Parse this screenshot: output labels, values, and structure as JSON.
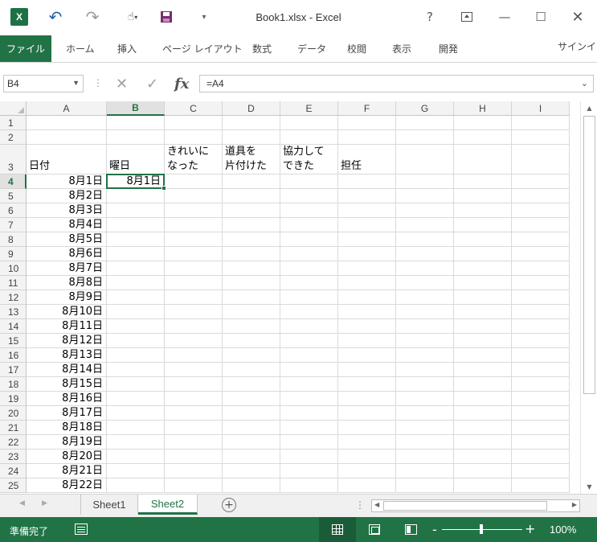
{
  "window": {
    "title": "Book1.xlsx - Excel",
    "logo_text": "X",
    "help": "?",
    "quick_access": [
      "undo-icon",
      "redo-icon",
      "touch-mode-icon",
      "save-icon",
      "customize-icon"
    ]
  },
  "ribbon": {
    "file_tab": "ファイル",
    "tabs": [
      "ホーム",
      "挿入",
      "ページ レイアウト",
      "数式",
      "データ",
      "校閲",
      "表示",
      "開発"
    ],
    "signin": "サインイン"
  },
  "formula_bar": {
    "name_box": "B4",
    "fx": "fx",
    "formula": "=A4"
  },
  "grid": {
    "columns": [
      "A",
      "B",
      "C",
      "D",
      "E",
      "F",
      "G",
      "H",
      "I"
    ],
    "selected_column": "B",
    "selected_row": "4",
    "rows": [
      {
        "n": "1",
        "cells": [
          "",
          "",
          "",
          "",
          "",
          "",
          "",
          "",
          ""
        ]
      },
      {
        "n": "2",
        "cells": [
          "",
          "",
          "",
          "",
          "",
          "",
          "",
          "",
          ""
        ]
      },
      {
        "n": "3",
        "cells": [
          "日付",
          "曜日",
          "きれいに\nなった",
          "道具を\n片付けた",
          "協力して\nできた",
          "担任",
          "",
          "",
          ""
        ]
      },
      {
        "n": "4",
        "cells": [
          "8月1日",
          "8月1日",
          "",
          "",
          "",
          "",
          "",
          "",
          ""
        ]
      },
      {
        "n": "5",
        "cells": [
          "8月2日",
          "",
          "",
          "",
          "",
          "",
          "",
          "",
          ""
        ]
      },
      {
        "n": "6",
        "cells": [
          "8月3日",
          "",
          "",
          "",
          "",
          "",
          "",
          "",
          ""
        ]
      },
      {
        "n": "7",
        "cells": [
          "8月4日",
          "",
          "",
          "",
          "",
          "",
          "",
          "",
          ""
        ]
      },
      {
        "n": "8",
        "cells": [
          "8月5日",
          "",
          "",
          "",
          "",
          "",
          "",
          "",
          ""
        ]
      },
      {
        "n": "9",
        "cells": [
          "8月6日",
          "",
          "",
          "",
          "",
          "",
          "",
          "",
          ""
        ]
      },
      {
        "n": "10",
        "cells": [
          "8月7日",
          "",
          "",
          "",
          "",
          "",
          "",
          "",
          ""
        ]
      },
      {
        "n": "11",
        "cells": [
          "8月8日",
          "",
          "",
          "",
          "",
          "",
          "",
          "",
          ""
        ]
      },
      {
        "n": "12",
        "cells": [
          "8月9日",
          "",
          "",
          "",
          "",
          "",
          "",
          "",
          ""
        ]
      },
      {
        "n": "13",
        "cells": [
          "8月10日",
          "",
          "",
          "",
          "",
          "",
          "",
          "",
          ""
        ]
      },
      {
        "n": "14",
        "cells": [
          "8月11日",
          "",
          "",
          "",
          "",
          "",
          "",
          "",
          ""
        ]
      },
      {
        "n": "15",
        "cells": [
          "8月12日",
          "",
          "",
          "",
          "",
          "",
          "",
          "",
          ""
        ]
      },
      {
        "n": "16",
        "cells": [
          "8月13日",
          "",
          "",
          "",
          "",
          "",
          "",
          "",
          ""
        ]
      },
      {
        "n": "17",
        "cells": [
          "8月14日",
          "",
          "",
          "",
          "",
          "",
          "",
          "",
          ""
        ]
      },
      {
        "n": "18",
        "cells": [
          "8月15日",
          "",
          "",
          "",
          "",
          "",
          "",
          "",
          ""
        ]
      },
      {
        "n": "19",
        "cells": [
          "8月16日",
          "",
          "",
          "",
          "",
          "",
          "",
          "",
          ""
        ]
      },
      {
        "n": "20",
        "cells": [
          "8月17日",
          "",
          "",
          "",
          "",
          "",
          "",
          "",
          ""
        ]
      },
      {
        "n": "21",
        "cells": [
          "8月18日",
          "",
          "",
          "",
          "",
          "",
          "",
          "",
          ""
        ]
      },
      {
        "n": "22",
        "cells": [
          "8月19日",
          "",
          "",
          "",
          "",
          "",
          "",
          "",
          ""
        ]
      },
      {
        "n": "23",
        "cells": [
          "8月20日",
          "",
          "",
          "",
          "",
          "",
          "",
          "",
          ""
        ]
      },
      {
        "n": "24",
        "cells": [
          "8月21日",
          "",
          "",
          "",
          "",
          "",
          "",
          "",
          ""
        ]
      },
      {
        "n": "25",
        "cells": [
          "8月22日",
          "",
          "",
          "",
          "",
          "",
          "",
          "",
          ""
        ]
      }
    ]
  },
  "sheets": {
    "tabs": [
      "Sheet1",
      "Sheet2"
    ],
    "active": "Sheet2",
    "add_label": "+"
  },
  "status": {
    "ready": "準備完了",
    "zoom": "100%",
    "zoom_minus": "-",
    "zoom_plus": "+",
    "zoom_level_percent": 100,
    "active_view": "normal"
  }
}
